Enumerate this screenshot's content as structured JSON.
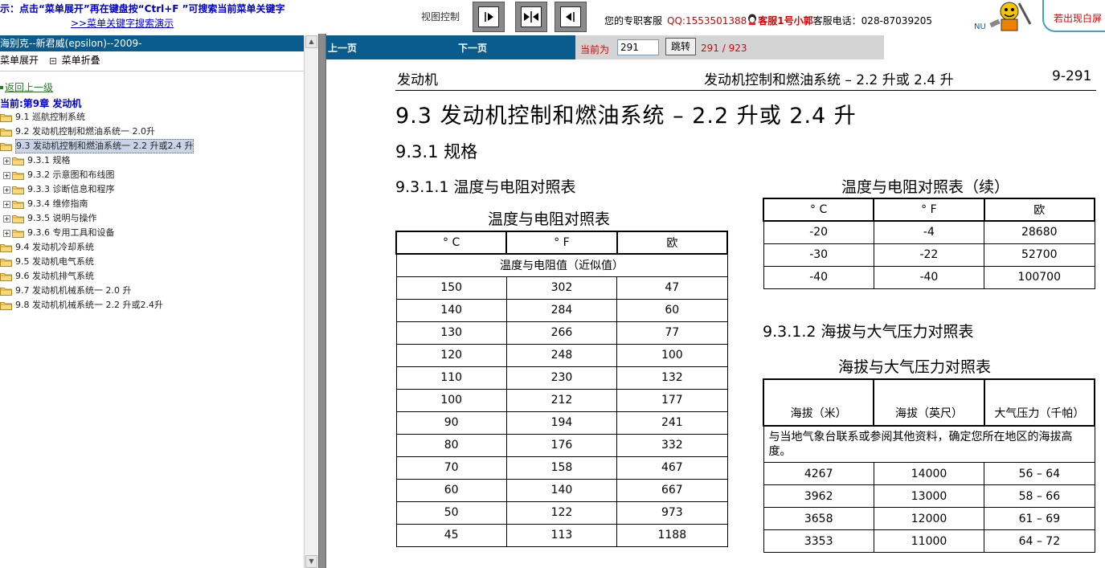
{
  "top": {
    "hint": "示：点击“菜单展开”再在键盘按“Ctrl+F ”可搜索当前菜单关键字",
    "demo_link": ">>菜单关键字搜索演示",
    "view_control_label": "视图控制",
    "service_label": "您的专职客服",
    "qq": "QQ:1553501388",
    "agent": "客服1号小郭",
    "tel_label": "客服电话：",
    "tel": "028-87039205",
    "nu_text": "NU",
    "exit_label": "若出现白屏"
  },
  "sidebar": {
    "title": "海别克--新君威(epsilon)--2009-",
    "expand_label": "菜单展开",
    "collapse_label": "菜单折叠",
    "back_label": "返回上一级",
    "current_label": "当前:第9章 发动机",
    "items": [
      {
        "label": "9.1 巡航控制系统",
        "expandable": false,
        "indent": 0,
        "selected": false
      },
      {
        "label": "9.2 发动机控制和燃油系统一 2.0升",
        "expandable": false,
        "indent": 0,
        "selected": false
      },
      {
        "label": "9.3 发动机控制和燃油系统一 2.2 升或2.4 升",
        "expandable": false,
        "indent": 0,
        "selected": true
      },
      {
        "label": "9.3.1 规格",
        "expandable": true,
        "indent": 1,
        "selected": false
      },
      {
        "label": "9.3.2 示意图和布线图",
        "expandable": true,
        "indent": 1,
        "selected": false
      },
      {
        "label": "9.3.3 诊断信息和程序",
        "expandable": true,
        "indent": 1,
        "selected": false
      },
      {
        "label": "9.3.4 维修指南",
        "expandable": true,
        "indent": 1,
        "selected": false
      },
      {
        "label": "9.3.5 说明与操作",
        "expandable": true,
        "indent": 1,
        "selected": false
      },
      {
        "label": "9.3.6 专用工具和设备",
        "expandable": true,
        "indent": 1,
        "selected": false
      },
      {
        "label": "9.4 发动机冷却系统",
        "expandable": false,
        "indent": 0,
        "selected": false
      },
      {
        "label": "9.5 发动机电气系统",
        "expandable": false,
        "indent": 0,
        "selected": false
      },
      {
        "label": "9.6 发动机排气系统",
        "expandable": false,
        "indent": 0,
        "selected": false
      },
      {
        "label": "9.7 发动机机械系统一 2.0 升",
        "expandable": false,
        "indent": 0,
        "selected": false
      },
      {
        "label": "9.8 发动机机械系统一 2.2 升或2.4升",
        "expandable": false,
        "indent": 0,
        "selected": false
      }
    ]
  },
  "nav": {
    "prev_label": "上一页",
    "next_label": "下一页",
    "current_label": "当前为",
    "page_value": "291",
    "jump_label": "跳转",
    "total": "291 / 923"
  },
  "document": {
    "header_left": "发动机",
    "header_right": "发动机控制和燃油系统 – 2.2 升或 2.4 升",
    "page_number": "9-291",
    "title": "9.3 发动机控制和燃油系统 – 2.2 升或 2.4 升",
    "section": "9.3.1 规格",
    "subsection1": "9.3.1.1 温度与电阻对照表",
    "subsection2": "9.3.1.2 海拔与大气压力对照表",
    "table1": {
      "caption": "温度与电阻对照表",
      "headers": [
        "° C",
        "° F",
        "欧"
      ],
      "group_label": "温度与电阻值（近似值）",
      "rows": [
        [
          "150",
          "302",
          "47"
        ],
        [
          "140",
          "284",
          "60"
        ],
        [
          "130",
          "266",
          "77"
        ],
        [
          "120",
          "248",
          "100"
        ],
        [
          "110",
          "230",
          "132"
        ],
        [
          "100",
          "212",
          "177"
        ],
        [
          "90",
          "194",
          "241"
        ],
        [
          "80",
          "176",
          "332"
        ],
        [
          "70",
          "158",
          "467"
        ],
        [
          "60",
          "140",
          "667"
        ],
        [
          "50",
          "122",
          "973"
        ],
        [
          "45",
          "113",
          "1188"
        ]
      ]
    },
    "table2": {
      "caption": "温度与电阻对照表（续）",
      "headers": [
        "° C",
        "° F",
        "欧"
      ],
      "rows": [
        [
          "-20",
          "-4",
          "28680"
        ],
        [
          "-30",
          "-22",
          "52700"
        ],
        [
          "-40",
          "-40",
          "100700"
        ]
      ]
    },
    "table3": {
      "caption": "海拔与大气压力对照表",
      "headers": [
        "海拔（米）",
        "海拔（英尺）",
        "大气压力（千帕）"
      ],
      "note": "与当地气象台联系或参阅其他资料，确定您所在地区的海拔高度。",
      "rows": [
        [
          "4267",
          "14000",
          "56 – 64"
        ],
        [
          "3962",
          "13000",
          "58 – 66"
        ],
        [
          "3658",
          "12000",
          "61 – 69"
        ],
        [
          "3353",
          "11000",
          "64 – 72"
        ]
      ]
    }
  }
}
